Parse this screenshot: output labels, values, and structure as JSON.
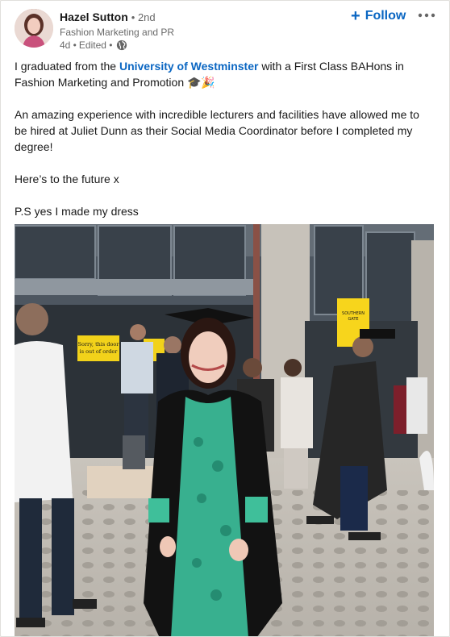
{
  "post": {
    "author": {
      "name": "Hazel Sutton",
      "degree": "• 2nd",
      "headline": "Fashion Marketing and PR",
      "time": "4d •",
      "edited": "Edited •",
      "avatar_icon": "avatar-photo",
      "visibility_icon": "globe-icon"
    },
    "follow_label": "Follow",
    "follow_icon": "plus-icon",
    "overflow_icon": "ellipsis-icon",
    "text": {
      "p1_before": "I graduated from the ",
      "p1_mention": "University of Westminster",
      "p1_after": " with a First Class BAHons in Fashion Marketing and Promotion 🎓🎉",
      "p2": "An amazing experience with incredible lecturers and facilities have allowed me to be hired at Juliet Dunn as their Social Media Coordinator before I completed my degree!",
      "p3": "Here’s to the future x",
      "p4": "P.S yes I made my dress"
    },
    "image": {
      "sign_left_line1": "Sorry, this door",
      "sign_left_line2": "is out of order",
      "sign_right_line1": "SOUTHERN",
      "sign_right_line2": "GATE"
    }
  },
  "colors": {
    "link": "#0a66c2",
    "text": "rgba(0,0,0,0.9)",
    "muted": "rgba(0,0,0,0.6)"
  }
}
